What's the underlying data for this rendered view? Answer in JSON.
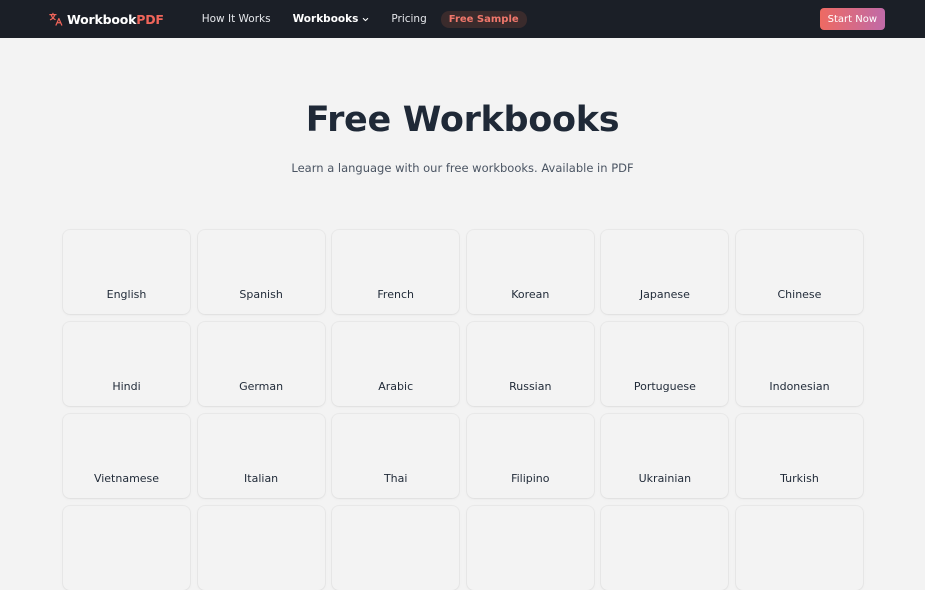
{
  "nav": {
    "brand_main": "Workbook",
    "brand_accent": "PDF",
    "links": {
      "how": "How It Works",
      "workbooks": "Workbooks",
      "pricing": "Pricing",
      "sample": "Free Sample"
    },
    "cta": "Start Now"
  },
  "hero": {
    "title": "Free Workbooks",
    "subtitle": "Learn a language with our free workbooks. Available in PDF"
  },
  "languages": [
    "English",
    "Spanish",
    "French",
    "Korean",
    "Japanese",
    "Chinese",
    "Hindi",
    "German",
    "Arabic",
    "Russian",
    "Portuguese",
    "Indonesian",
    "Vietnamese",
    "Italian",
    "Thai",
    "Filipino",
    "Ukrainian",
    "Turkish"
  ],
  "colors": {
    "nav_bg": "#1b1f27",
    "accent": "#f0655a",
    "page_bg": "#f3f3f3"
  },
  "icons": {
    "brand": "translate-icon",
    "workbooks_dropdown": "chevron-down-icon"
  }
}
